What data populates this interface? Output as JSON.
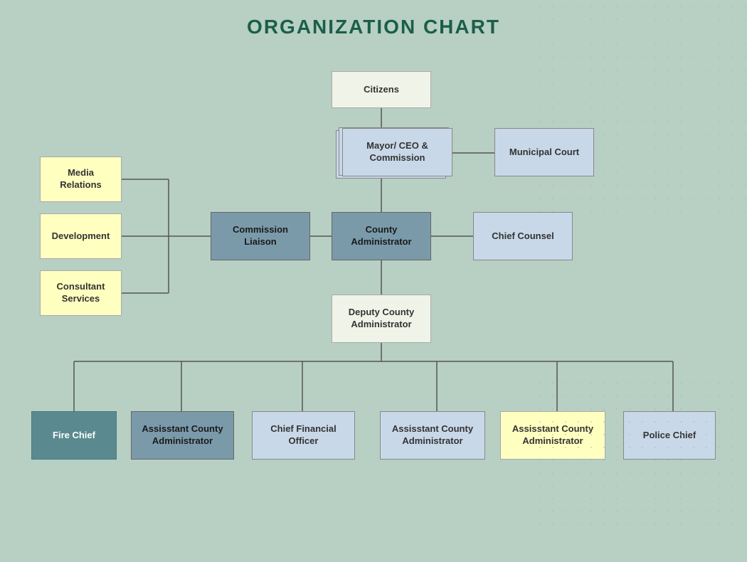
{
  "title": "ORGANIZATION CHART",
  "nodes": {
    "citizens": {
      "label": "Citizens"
    },
    "mayor": {
      "label": "Mayor/\nCEO & Commission"
    },
    "municipal_court": {
      "label": "Municipal Court"
    },
    "county_admin": {
      "label": "County\nAdministrator"
    },
    "commission_liaison": {
      "label": "Commission\nLiaison"
    },
    "chief_counsel": {
      "label": "Chief Counsel"
    },
    "media_relations": {
      "label": "Media Relations"
    },
    "development": {
      "label": "Development"
    },
    "consultant_services": {
      "label": "Consultant\nServices"
    },
    "deputy_county_admin": {
      "label": "Deputy County\nAdministrator"
    },
    "fire_chief": {
      "label": "Fire Chief"
    },
    "asst_admin_1": {
      "label": "Assisstant County\nAdministrator"
    },
    "cfo": {
      "label": "Chief Financial\nOfficer"
    },
    "asst_admin_2": {
      "label": "Assisstant County\nAdministrator"
    },
    "asst_admin_3": {
      "label": "Assisstant County\nAdministrator"
    },
    "police_chief": {
      "label": "Police Chief"
    }
  }
}
